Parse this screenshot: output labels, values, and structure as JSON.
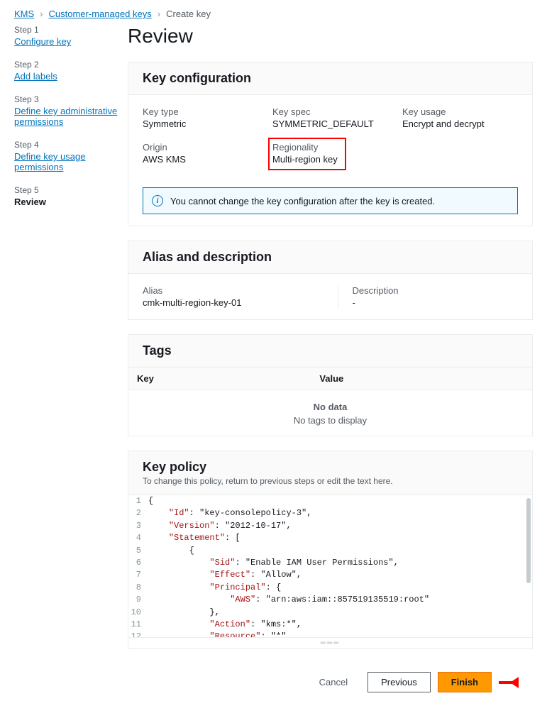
{
  "breadcrumb": {
    "root": "KMS",
    "mid": "Customer-managed keys",
    "leaf": "Create key"
  },
  "steps": [
    {
      "num": "Step 1",
      "label": "Configure key",
      "current": false
    },
    {
      "num": "Step 2",
      "label": "Add labels",
      "current": false
    },
    {
      "num": "Step 3",
      "label": "Define key administrative permissions",
      "current": false
    },
    {
      "num": "Step 4",
      "label": "Define key usage permissions",
      "current": false
    },
    {
      "num": "Step 5",
      "label": "Review",
      "current": true
    }
  ],
  "page_title": "Review",
  "keyconfig": {
    "title": "Key configuration",
    "rows": {
      "keytype_l": "Key type",
      "keytype_v": "Symmetric",
      "keyspec_l": "Key spec",
      "keyspec_v": "SYMMETRIC_DEFAULT",
      "keyusage_l": "Key usage",
      "keyusage_v": "Encrypt and decrypt",
      "origin_l": "Origin",
      "origin_v": "AWS KMS",
      "regionality_l": "Regionality",
      "regionality_v": "Multi-region key"
    },
    "info": "You cannot change the key configuration after the key is created."
  },
  "alias": {
    "title": "Alias and description",
    "alias_l": "Alias",
    "alias_v": "cmk-multi-region-key-01",
    "desc_l": "Description",
    "desc_v": "-"
  },
  "tags": {
    "title": "Tags",
    "col_key": "Key",
    "col_val": "Value",
    "empty_title": "No data",
    "empty_sub": "No tags to display"
  },
  "policy": {
    "title": "Key policy",
    "sub": "To change this policy, return to previous steps or edit the text here.",
    "lines": [
      "{",
      "    \"Id\": \"key-consolepolicy-3\",",
      "    \"Version\": \"2012-10-17\",",
      "    \"Statement\": [",
      "        {",
      "            \"Sid\": \"Enable IAM User Permissions\",",
      "            \"Effect\": \"Allow\",",
      "            \"Principal\": {",
      "                \"AWS\": \"arn:aws:iam::857519135519:root\"",
      "            },",
      "            \"Action\": \"kms:*\",",
      "            \"Resource\": \"*\"",
      "        }",
      "    ]"
    ]
  },
  "footer": {
    "cancel": "Cancel",
    "previous": "Previous",
    "finish": "Finish"
  }
}
